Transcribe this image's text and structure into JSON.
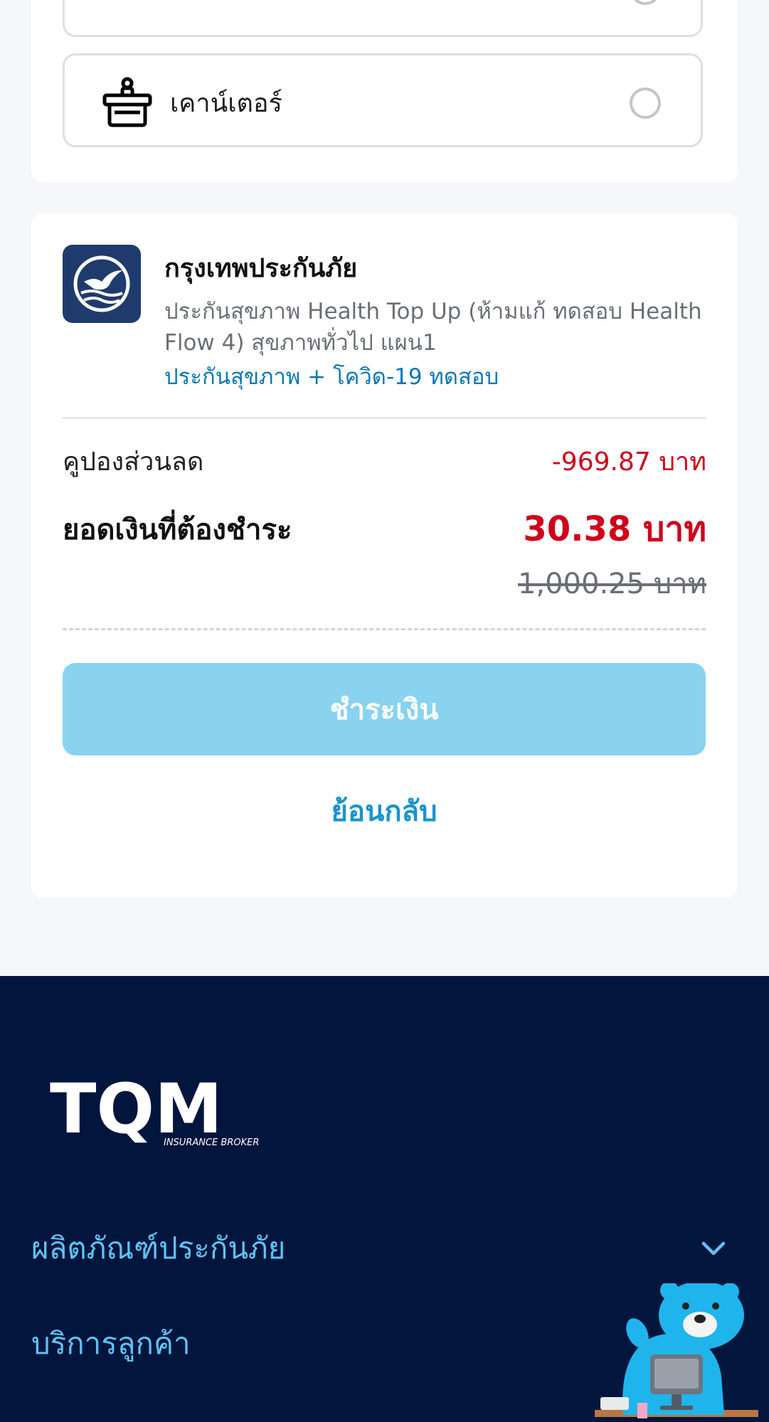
{
  "payment_methods": {
    "counter_label": "เคาน์เตอร์"
  },
  "summary": {
    "insurer_name": "กรุงเทพประกันภัย",
    "plan_name": "ประกันสุขภาพ Health Top Up (ห้ามแก้ ทดสอบ Health Flow 4) สุขภาพทั่วไป แผน1",
    "plan_tag": "ประกันสุขภาพ + โควิด-19 ทดสอบ",
    "coupon_label": "คูปองส่วนลด",
    "coupon_value": "-969.87 บาท",
    "total_label": "ยอดเงินที่ต้องชำระ",
    "total_value": "30.38 บาท",
    "original_value": "1,000.25 บาท",
    "pay_button_label": "ชำระเงิน",
    "back_link_label": "ย้อนกลับ"
  },
  "footer": {
    "brand_name": "TQM",
    "brand_sub": "INSURANCE BROKER",
    "menu": [
      {
        "label": "ผลิตภัณฑ์ประกันภัย"
      },
      {
        "label": "บริการลูกค้า"
      }
    ]
  },
  "colors": {
    "accent": "#1993cf",
    "price_red": "#d0021b",
    "footer_bg": "#02153d",
    "pay_button": "#89d3f0"
  }
}
